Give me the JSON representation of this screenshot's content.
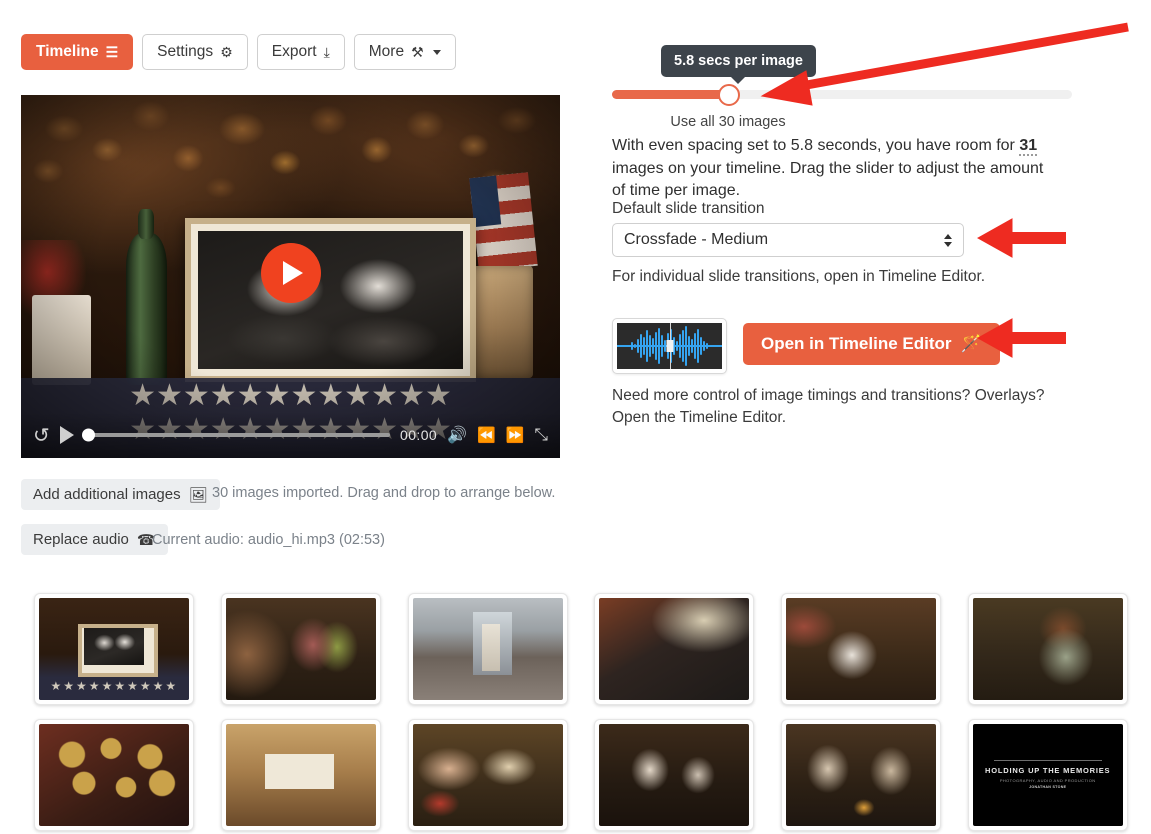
{
  "toolbar": {
    "buttons": [
      {
        "label": "Timeline",
        "icon": "hamburger-icon",
        "glyph": "☰",
        "primary": true,
        "caret": false
      },
      {
        "label": "Settings",
        "icon": "gear-icon",
        "glyph": "⚙",
        "primary": false,
        "caret": false
      },
      {
        "label": "Export",
        "icon": "download-icon",
        "glyph": "⤓",
        "primary": false,
        "caret": false
      },
      {
        "label": "More",
        "icon": "tools-icon",
        "glyph": "⚒",
        "primary": false,
        "caret": true
      }
    ]
  },
  "player": {
    "play_overlay_icon": "play-icon",
    "controls": {
      "replay_icon": "replay-icon",
      "replay_glyph": "↺",
      "play_icon": "play-icon",
      "current_time": "00:00",
      "volume_icon": "volume-icon",
      "volume_glyph": "🔊",
      "rewind_icon": "rewind-icon",
      "rewind_glyph": "⏪",
      "forward_icon": "fast-forward-icon",
      "forward_glyph": "⏩",
      "fullscreen_icon": "fullscreen-icon",
      "fullscreen_glyph": "⤡",
      "progress_percent": 0
    }
  },
  "timing": {
    "tooltip": "5.8 secs per image",
    "slider_caption": "Use all 30 images",
    "slider_percent": 25.5,
    "description_pre": "With even spacing set to 5.8 seconds, you have room for ",
    "description_count": "31",
    "description_post": " images on your timeline. Drag the slider to adjust the amount of time per image."
  },
  "transition": {
    "label": "Default slide transition",
    "selected": "Crossfade - Medium",
    "note": "For individual slide transitions, open in Timeline Editor."
  },
  "editor": {
    "waveform_alt": "audio-waveform-thumbnail",
    "button_label": "Open in Timeline Editor",
    "button_icon": "magic-wand-icon",
    "button_glyph": "🪄",
    "note_line1": "Need more control of image timings and transitions? Overlays?",
    "note_line2": "Open the Timeline Editor."
  },
  "media_actions": {
    "add_images_label": "Add additional images",
    "add_images_icon": "image-icon",
    "add_images_glyph": "🖼",
    "add_images_status": "30 images imported. Drag and drop to arrange below.",
    "replace_audio_label": "Replace audio",
    "replace_audio_icon": "headphones-icon",
    "replace_audio_glyph": "☎",
    "replace_audio_status": "Current audio: audio_hi.mp3 (02:53)"
  },
  "thumbnails": {
    "rows": [
      [
        {
          "name": "thumb-framed-portrait",
          "class": "t1",
          "stars": true
        },
        {
          "name": "thumb-shop-interior-people",
          "class": "t2"
        },
        {
          "name": "thumb-porch-woman",
          "class": "t3"
        },
        {
          "name": "thumb-cash-register",
          "class": "t4"
        },
        {
          "name": "thumb-store-counter-woman",
          "class": "t5"
        },
        {
          "name": "thumb-smiling-woman-shelves",
          "class": "t6"
        }
      ],
      [
        {
          "name": "thumb-brass-buttons",
          "class": "t7"
        },
        {
          "name": "thumb-wooden-box",
          "class": "t8"
        },
        {
          "name": "thumb-hands-holding-photo",
          "class": "t9"
        },
        {
          "name": "thumb-two-women-table",
          "class": "t10"
        },
        {
          "name": "thumb-women-dining",
          "class": "t11"
        },
        {
          "name": "thumb-title-card",
          "class": "t12",
          "title_card": {
            "main": "HOLDING UP THE MEMORIES",
            "sub": "PHOTOGRAPHY, AUDIO AND PRODUCTION",
            "name": "JONATHAN STONE"
          }
        }
      ]
    ]
  },
  "colors": {
    "brand_orange": "#e8603f",
    "play_red": "#f0421f",
    "slider_fill": "#e8694a",
    "tooltip_bg": "#3d444b",
    "annotation_red": "#ee2b21",
    "waveform_blue": "#35a4f0"
  }
}
